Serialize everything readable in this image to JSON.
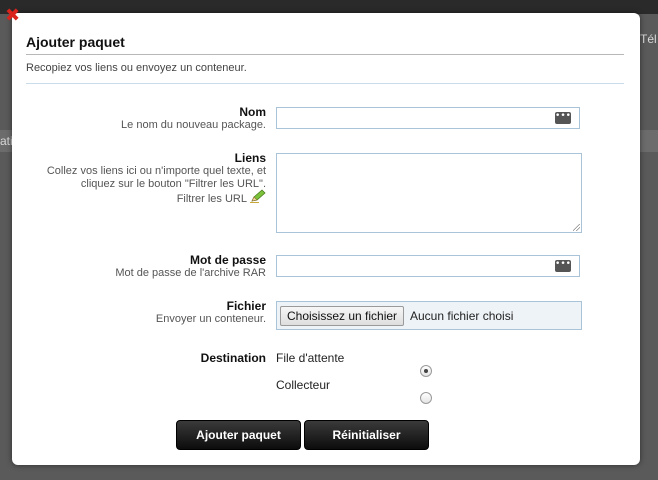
{
  "background": {
    "right_text": "Tél",
    "left_text": "atic"
  },
  "dialog": {
    "title": "Ajouter paquet",
    "description": "Recopiez vos liens ou envoyez un conteneur.",
    "close_icon": "close-icon",
    "colors": {
      "close": "#d9231c",
      "button": "#1a1a1a",
      "input_border": "#a9c3d8"
    }
  },
  "form": {
    "name": {
      "label": "Nom",
      "help": "Le nom du nouveau package.",
      "value": "",
      "icon": "dots-icon"
    },
    "links": {
      "label": "Liens",
      "help_line1": "Collez vos liens ici ou n'importe quel texte, et",
      "help_line2": "cliquez sur le bouton \"Filtrer les URL\".",
      "filter_label": "Filtrer les URL",
      "filter_icon": "pencil-icon",
      "value": ""
    },
    "password": {
      "label": "Mot de passe",
      "help": "Mot de passe de l'archive RAR",
      "value": "",
      "icon": "dots-icon"
    },
    "file": {
      "label": "Fichier",
      "help": "Envoyer un conteneur.",
      "button": "Choisissez un fichier",
      "status": "Aucun fichier choisi"
    },
    "destination": {
      "label": "Destination",
      "options": [
        {
          "label": "File d'attente",
          "selected": true
        },
        {
          "label": "Collecteur",
          "selected": false
        }
      ]
    }
  },
  "buttons": {
    "submit": "Ajouter paquet",
    "reset": "Réinitialiser"
  }
}
